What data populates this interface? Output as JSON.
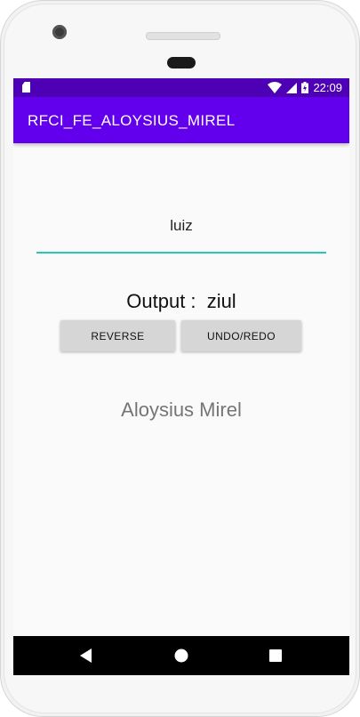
{
  "status_bar": {
    "time": "22:09",
    "color": "#4e00b5",
    "icons": [
      "sd-card-icon",
      "wifi-icon",
      "signal-icon",
      "battery-charging-icon"
    ]
  },
  "app_bar": {
    "title": "RFCI_FE_ALOYSIUS_MIREL",
    "color": "#6200ee"
  },
  "input": {
    "value": "luiz",
    "underline_color": "#26c6b9"
  },
  "output": {
    "label": "Output :",
    "value": "ziul"
  },
  "buttons": {
    "reverse_label": "REVERSE",
    "undo_redo_label": "UNDO/REDO"
  },
  "author": {
    "name": "Aloysius Mirel"
  },
  "nav_bar": {
    "icons": [
      "back-icon",
      "home-icon",
      "recents-icon"
    ]
  }
}
